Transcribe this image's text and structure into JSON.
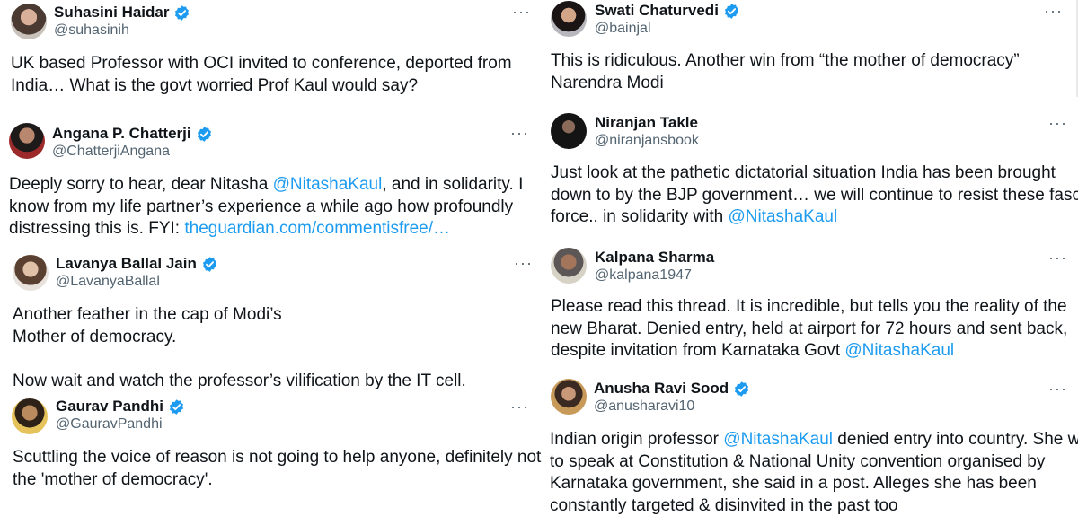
{
  "colors": {
    "text": "#0f1419",
    "secondary": "#536471",
    "link": "#1d9bf0",
    "verified": "#1d9bf0"
  },
  "icons": {
    "verified": "verified-badge-icon",
    "more": "more-options-icon"
  },
  "tweets": [
    {
      "name": "Suhasini Haidar",
      "handle": "@suhasinih",
      "more": "···",
      "lines": [
        [
          {
            "t": "UK based Professor with OCI invited to conference, deported from"
          }
        ],
        [
          {
            "t": "India… What is the govt worried Prof Kaul would say?"
          }
        ]
      ]
    },
    {
      "name": "Angana P. Chatterji",
      "handle": "@ChatterjiAngana",
      "more": "···",
      "lines": [
        [
          {
            "t": "Deeply sorry to hear, dear Nitasha "
          },
          {
            "t": "@NitashaKaul",
            "link": true
          },
          {
            "t": ", and in solidarity. I"
          }
        ],
        [
          {
            "t": "know from my life partner’s experience a while ago how profoundly"
          }
        ],
        [
          {
            "t": "distressing this is. FYI: "
          },
          {
            "t": "theguardian.com/commentisfree/…",
            "link": true
          }
        ]
      ]
    },
    {
      "name": "Lavanya Ballal Jain",
      "handle": "@LavanyaBallal",
      "more": "···",
      "lines": [
        [
          {
            "t": "Another feather in the cap of Modi’s"
          }
        ],
        [
          {
            "t": "Mother of democracy."
          }
        ],
        [],
        [
          {
            "t": "Now wait and watch  the professor’s vilification by the IT cell."
          }
        ]
      ]
    },
    {
      "name": "Gaurav Pandhi",
      "handle": "@GauravPandhi",
      "more": "···",
      "lines": [
        [
          {
            "t": "Scuttling the voice of reason is not going to help anyone, definitely not"
          }
        ],
        [
          {
            "t": "the 'mother of democracy'."
          }
        ]
      ]
    },
    {
      "name": "Swati Chaturvedi",
      "handle": "@bainjal",
      "more": "···",
      "lines": [
        [
          {
            "t": "This is ridiculous. Another win from “the mother of democracy”"
          }
        ],
        [
          {
            "t": "Narendra Modi"
          }
        ]
      ]
    },
    {
      "name": "Niranjan Takle",
      "handle": "@niranjansbook",
      "more": "···",
      "lines": [
        [
          {
            "t": "Just look at the pathetic dictatorial situation India has been brought"
          }
        ],
        [
          {
            "t": "down to by the BJP government… we will continue to resist these fascist"
          }
        ],
        [
          {
            "t": "force.. in solidarity with "
          },
          {
            "t": "@NitashaKaul",
            "link": true
          }
        ]
      ]
    },
    {
      "name": "Kalpana Sharma",
      "handle": "@kalpana1947",
      "more": "···",
      "lines": [
        [
          {
            "t": "Please read this thread. It is incredible, but tells you the reality of the"
          }
        ],
        [
          {
            "t": "new Bharat. Denied entry, held at airport for 72 hours and sent back,"
          }
        ],
        [
          {
            "t": "despite invitation from Karnataka Govt "
          },
          {
            "t": "@NitashaKaul",
            "link": true
          }
        ]
      ]
    },
    {
      "name": "Anusha Ravi Sood",
      "handle": "@anusharavi10",
      "more": "···",
      "lines": [
        [
          {
            "t": "Indian origin professor "
          },
          {
            "t": "@NitashaKaul",
            "link": true
          },
          {
            "t": " denied entry into country. She was"
          }
        ],
        [
          {
            "t": "to speak at Constitution & National Unity convention organised by"
          }
        ],
        [
          {
            "t": "Karnataka government, she said in a post. Alleges she has been"
          }
        ],
        [
          {
            "t": "constantly targeted & disinvited in the past too"
          }
        ]
      ]
    }
  ]
}
